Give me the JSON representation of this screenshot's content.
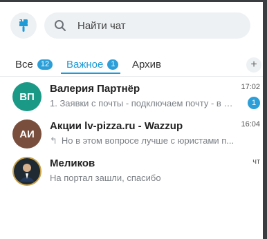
{
  "search": {
    "placeholder": "Найти чат"
  },
  "tabs": [
    {
      "label": "Все",
      "count": "12"
    },
    {
      "label": "Важное",
      "count": "1"
    },
    {
      "label": "Архив"
    }
  ],
  "add_tab_label": "+",
  "chats": [
    {
      "initials": "ВП",
      "avatar_color": "#1a9a86",
      "name": "Валерия Партнёр",
      "preview": "1. Заявки с почты - подключаем почту - в н...",
      "time": "17:02",
      "unread": "1"
    },
    {
      "initials": "АИ",
      "avatar_color": "#7a4e3c",
      "name": "Акции lv-pizza.ru - Wazzup",
      "preview": "Но в этом вопросе лучше с юристами п...",
      "time": "16:04"
    },
    {
      "initials": "",
      "avatar_color": "#2b2b2b",
      "name": "Меликов",
      "preview": "На портал зашли, спасибо",
      "time": "чт"
    }
  ],
  "colors": {
    "accent": "#1e9bd7",
    "badge": "#2d9fd8"
  }
}
